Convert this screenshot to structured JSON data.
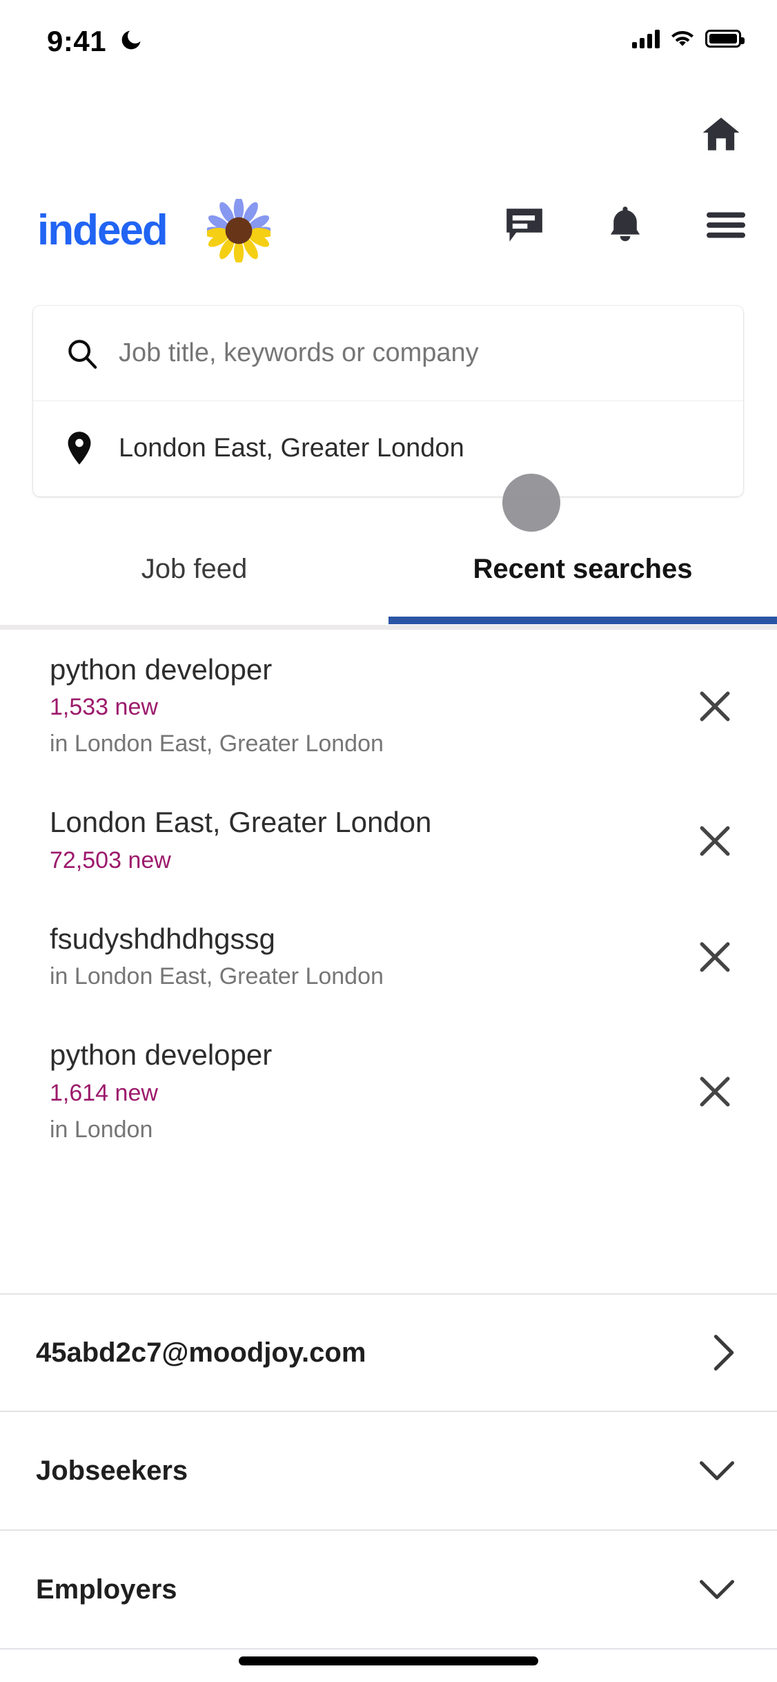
{
  "status_bar": {
    "time": "9:41",
    "moon_icon": "moon-icon",
    "signal_icon": "cellular-signal-icon",
    "wifi_icon": "wifi-icon",
    "battery_icon": "battery-full-icon"
  },
  "header": {
    "home_icon": "home-icon",
    "logo_text": "indeed",
    "logo_color": "#2164f3",
    "sunflower_icon": "sunflower-icon",
    "messages_icon": "message-bubble-icon",
    "notifications_icon": "bell-icon",
    "menu_icon": "hamburger-menu-icon"
  },
  "search": {
    "query_icon": "search-icon",
    "query_placeholder": "Job title, keywords or company",
    "query_value": "",
    "location_icon": "location-pin-icon",
    "location_value": "London East, Greater London"
  },
  "tabs": {
    "active_index": 1,
    "active_color": "#2a55a5",
    "items": [
      {
        "label": "Job feed"
      },
      {
        "label": "Recent searches"
      }
    ]
  },
  "recent_searches": {
    "new_count_color": "#9c1a6c",
    "close_icon": "close-x-icon",
    "items": [
      {
        "title": "python developer",
        "new_count": "1,533 new",
        "location": "in London East, Greater London"
      },
      {
        "title": "London East, Greater London",
        "new_count": "72,503 new",
        "location": ""
      },
      {
        "title": "fsudyshdhdhgssg",
        "new_count": "",
        "location": "in London East, Greater London"
      },
      {
        "title": "python developer",
        "new_count": "1,614 new",
        "location": "in London"
      }
    ]
  },
  "account": {
    "rows": [
      {
        "label": "45abd2c7@moodjoy.com",
        "icon": "chevron-right-icon"
      },
      {
        "label": "Jobseekers",
        "icon": "chevron-down-icon"
      },
      {
        "label": "Employers",
        "icon": "chevron-down-icon"
      }
    ]
  },
  "system": {
    "home_indicator": "home-indicator-bar"
  }
}
